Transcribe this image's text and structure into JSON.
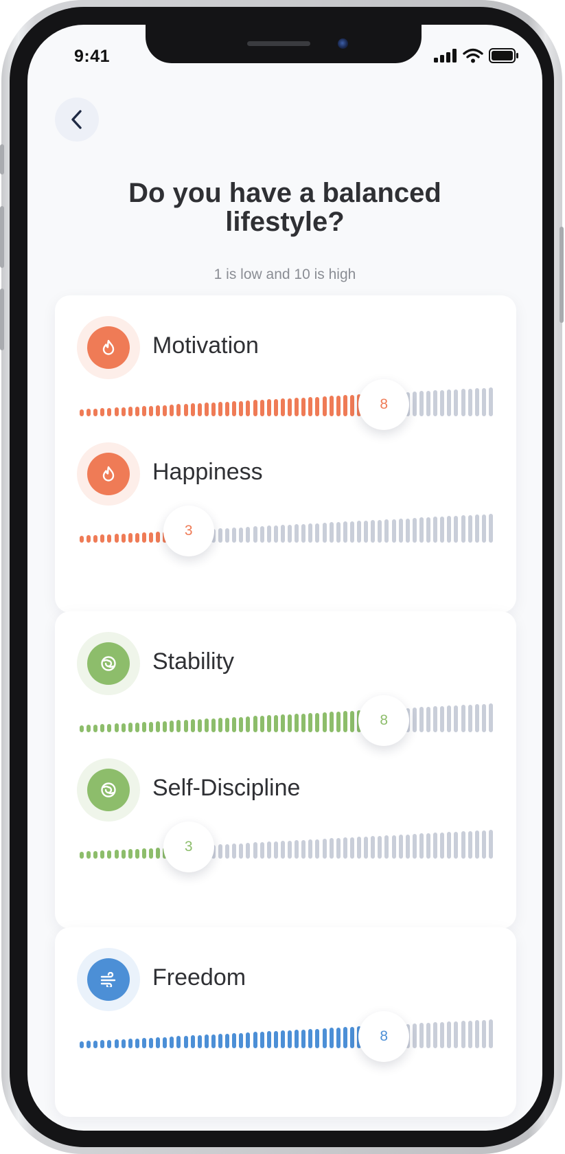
{
  "status_bar": {
    "time": "9:41"
  },
  "page": {
    "title_line1": "Do you have a balanced",
    "title_line2": "lifestyle?",
    "subtitle": "1 is low and 10 is high"
  },
  "colors": {
    "orange": "#ef7b56",
    "orange_halo": "#fdeee9",
    "green": "#8dbd6b",
    "green_halo": "#eff5ea",
    "blue": "#4c8fd6",
    "blue_halo": "#eaf2fb",
    "inactive": "#c9ced9"
  },
  "groups": [
    {
      "theme": "orange",
      "icon": "flame-icon",
      "items": [
        {
          "label": "Motivation",
          "value": 8
        },
        {
          "label": "Happiness",
          "value": 3
        }
      ]
    },
    {
      "theme": "green",
      "icon": "swirl-icon",
      "items": [
        {
          "label": "Stability",
          "value": 8
        },
        {
          "label": "Self-Discipline",
          "value": 3
        }
      ]
    },
    {
      "theme": "blue",
      "icon": "wind-icon",
      "items": [
        {
          "label": "Freedom",
          "value": 8
        }
      ]
    }
  ]
}
